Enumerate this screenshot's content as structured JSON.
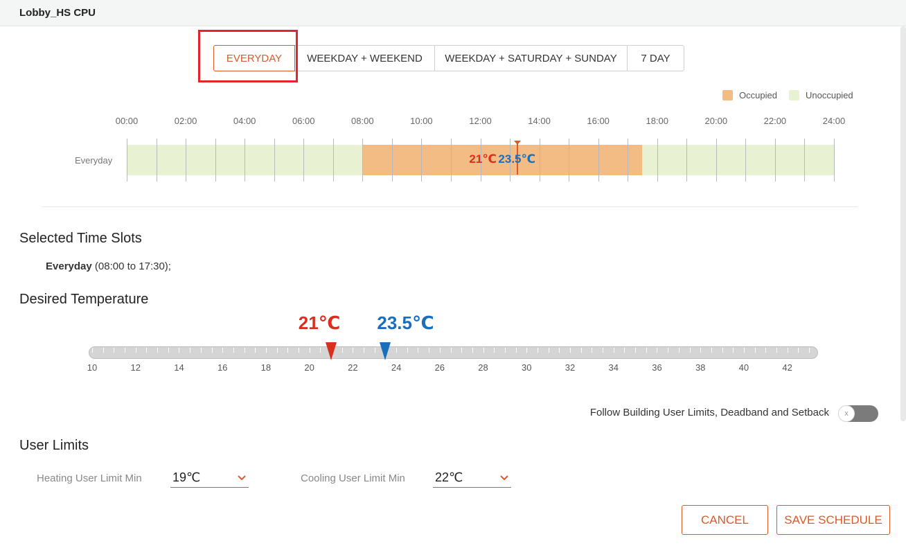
{
  "window": {
    "title": "Lobby_HS CPU"
  },
  "modes": {
    "active_index": 0,
    "tabs": [
      {
        "label": "EVERYDAY"
      },
      {
        "label": "WEEKDAY + WEEKEND"
      },
      {
        "label": "WEEKDAY + SATURDAY + SUNDAY"
      },
      {
        "label": "7 DAY"
      }
    ]
  },
  "legend": {
    "occupied": {
      "label": "Occupied",
      "color": "#f3bc85"
    },
    "unoccupied": {
      "label": "Unoccupied",
      "color": "#e8f2d3"
    }
  },
  "schedule": {
    "hour_labels": [
      "00:00",
      "02:00",
      "04:00",
      "06:00",
      "08:00",
      "10:00",
      "12:00",
      "14:00",
      "16:00",
      "18:00",
      "20:00",
      "22:00",
      "24:00"
    ],
    "row_label": "Everyday",
    "occupied_start_hour": 8,
    "occupied_end_hour": 17.5,
    "current_time_hour": 13.25,
    "slot_heat_label": "21℃",
    "slot_cool_label": "23.5℃"
  },
  "selected_time_slots": {
    "title": "Selected Time Slots",
    "day": "Everyday",
    "range": " (08:00 to 17:30);"
  },
  "desired_temperature": {
    "title": "Desired Temperature",
    "min": 10,
    "max": 43,
    "tick_labels": [
      "10",
      "12",
      "14",
      "16",
      "18",
      "20",
      "22",
      "24",
      "26",
      "28",
      "30",
      "32",
      "34",
      "36",
      "38",
      "40",
      "42"
    ],
    "heat": {
      "value": 21,
      "label": "21℃",
      "color": "#d8301f"
    },
    "cool": {
      "value": 23.5,
      "label": "23.5℃",
      "color": "#1a6fbd"
    }
  },
  "follow_building": {
    "label": "Follow Building User Limits, Deadband and Setback",
    "enabled": false,
    "knob_glyph": "x"
  },
  "user_limits": {
    "title": "User Limits",
    "heating_min": {
      "label": "Heating User Limit Min",
      "value": "19℃"
    },
    "cooling_min": {
      "label": "Cooling User Limit Min",
      "value": "22℃"
    }
  },
  "actions": {
    "cancel": "CANCEL",
    "save": "SAVE SCHEDULE"
  },
  "colors": {
    "accent": "#d9592b",
    "heat": "#d8301f",
    "cool": "#1a6fbd"
  }
}
